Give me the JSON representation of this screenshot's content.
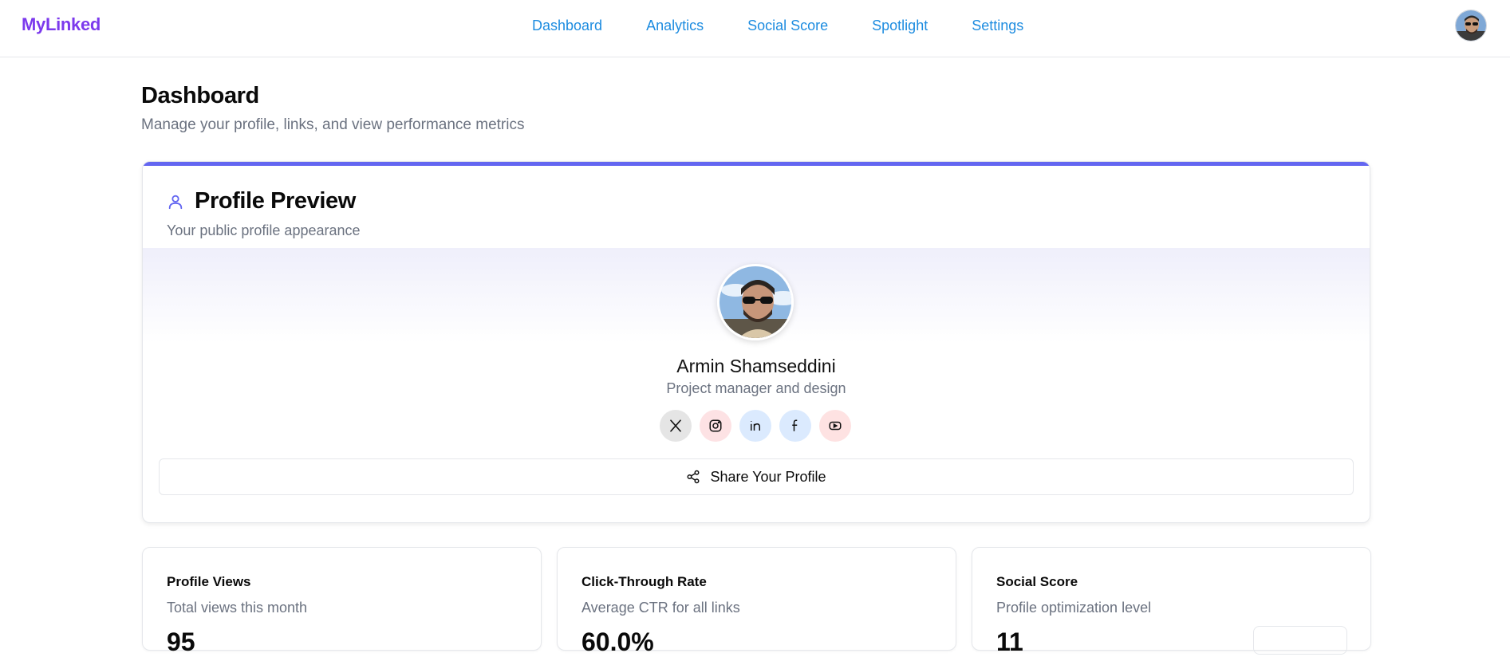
{
  "header": {
    "brand": "MyLinked",
    "nav": [
      "Dashboard",
      "Analytics",
      "Social Score",
      "Spotlight",
      "Settings"
    ]
  },
  "page": {
    "title": "Dashboard",
    "subtitle": "Manage your profile, links, and view performance metrics"
  },
  "profile_card": {
    "title": "Profile Preview",
    "subtitle": "Your public profile appearance",
    "name": "Armin Shamseddini",
    "bio": "Project manager and design",
    "share_label": "Share Your Profile",
    "socials": [
      {
        "icon": "x-icon",
        "bg": "#e5e5e5"
      },
      {
        "icon": "instagram-icon",
        "bg": "#fde2e4"
      },
      {
        "icon": "linkedin-icon",
        "bg": "#dbeafe"
      },
      {
        "icon": "facebook-icon",
        "bg": "#dbeafe"
      },
      {
        "icon": "youtube-icon",
        "bg": "#fee2e2"
      }
    ],
    "accent": "#6366f1"
  },
  "stats": [
    {
      "title": "Profile Views",
      "desc": "Total views this month",
      "value": "95"
    },
    {
      "title": "Click-Through Rate",
      "desc": "Average CTR for all links",
      "value": "60.0%"
    },
    {
      "title": "Social Score",
      "desc": "Profile optimization level",
      "value": "11"
    }
  ]
}
